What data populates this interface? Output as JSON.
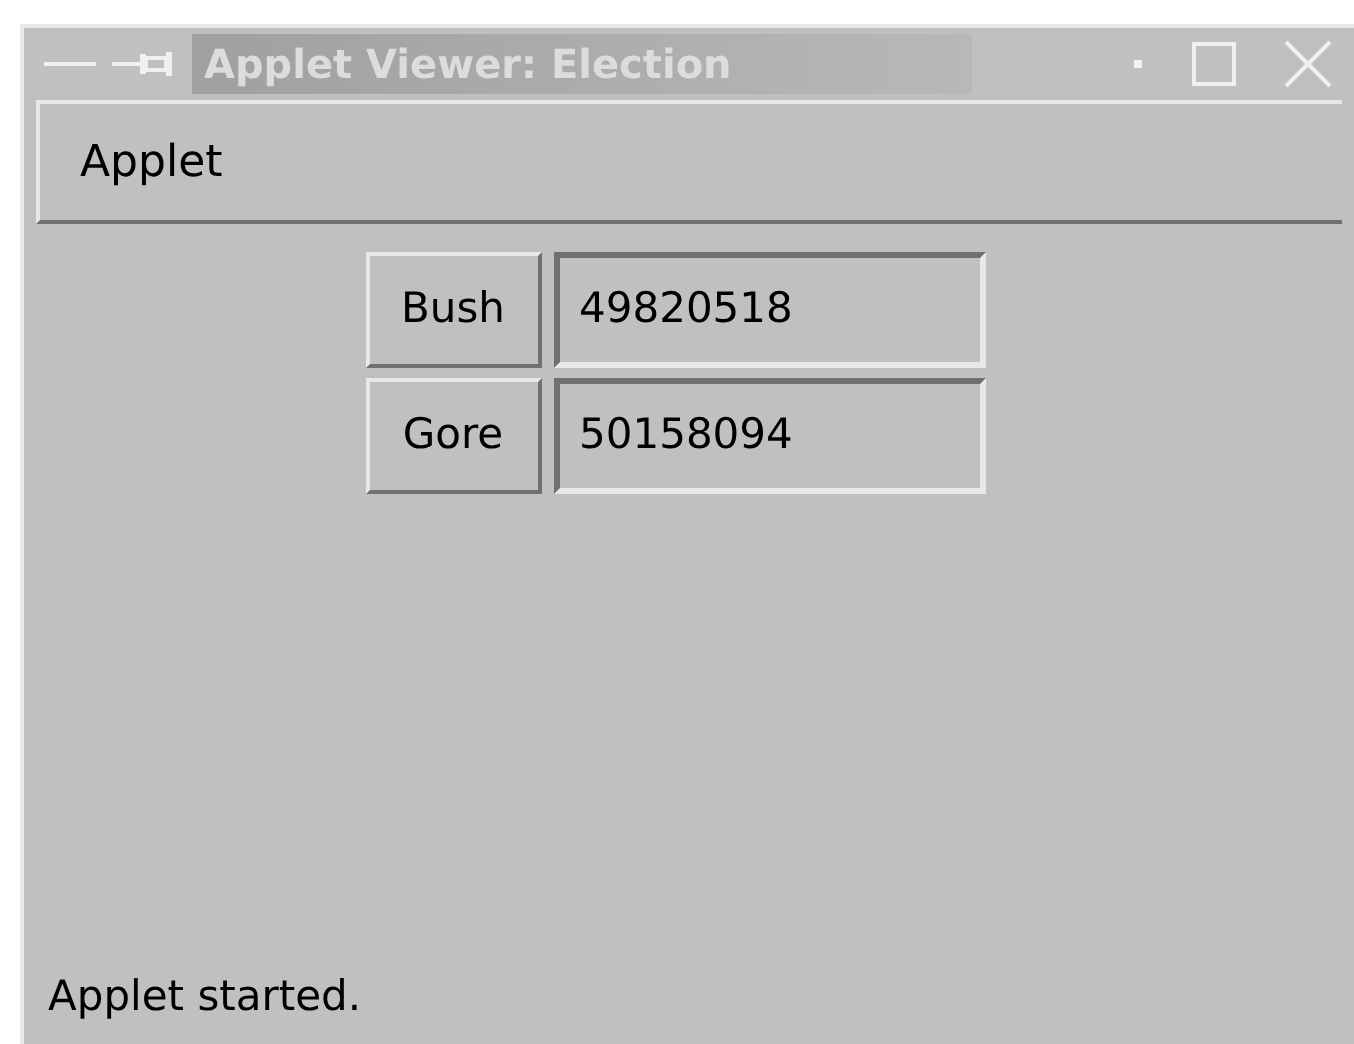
{
  "window": {
    "title": "Applet Viewer: Election"
  },
  "menu": [
    "Applet"
  ],
  "candidates": [
    {
      "name": "Bush",
      "votes": "49820518"
    },
    {
      "name": "Gore",
      "votes": "50158094"
    }
  ],
  "status_bar": "Applet started."
}
